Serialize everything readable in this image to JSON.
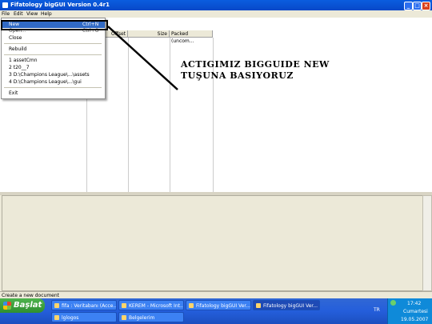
{
  "window": {
    "title": "Fifatology bigGUI Version 0.4r1"
  },
  "menubar": {
    "items": [
      "File",
      "Edit",
      "View",
      "Help"
    ]
  },
  "columns": {
    "offset": "Offset",
    "size": "Size",
    "packed": "Packed (uncom..."
  },
  "file_menu": {
    "new": {
      "label": "New",
      "shortcut": "Ctrl+N"
    },
    "open": {
      "label": "Open...",
      "shortcut": "Ctrl+O"
    },
    "close": "Close",
    "rebuild": "Rebuild",
    "recent": [
      "1 assetCmn",
      "2 t20__7",
      "3 D:\\Champions League\\...\\assets",
      "4 D:\\Champions League\\...\\gui"
    ],
    "exit": "Exit"
  },
  "annotation": "ACTIGIMIZ BIGGUIDE NEW TUŞUNA BASIYORUZ",
  "statusbar": "Create a new document",
  "taskbar": {
    "start": "Başlat",
    "tasks": [
      "fifa : Veritabanı (Acce...",
      "KEREM - Microsoft Int...",
      "Fifatology bigGUI Ver...",
      "Fifatology bigGUI Ver..."
    ],
    "tasks_row2": [
      "lglogos",
      "Belgelerim"
    ],
    "lang": "TR",
    "time": "17:42",
    "day": "Cumartesi",
    "date": "19.05.2007"
  }
}
